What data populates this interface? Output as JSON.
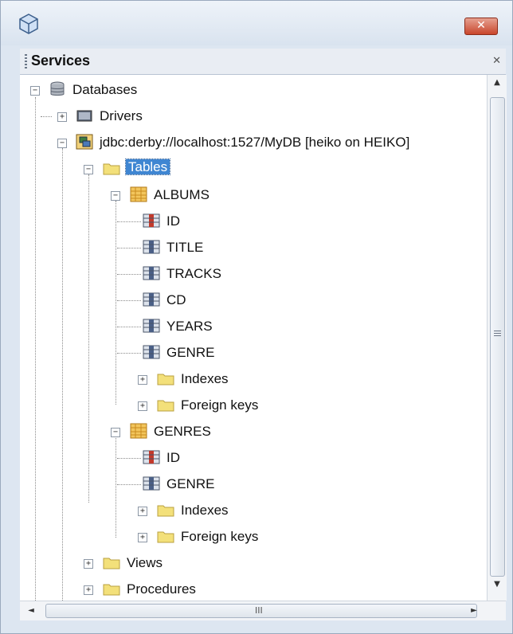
{
  "window": {
    "close_glyph": "✕"
  },
  "panel": {
    "title": "Services",
    "close_glyph": "✕"
  },
  "tree": {
    "root": "Databases",
    "drivers": "Drivers",
    "connection": "jdbc:derby://localhost:1527/MyDB [heiko on HEIKO]",
    "tables": "Tables",
    "albums": {
      "name": "ALBUMS",
      "columns": [
        "ID",
        "TITLE",
        "TRACKS",
        "CD",
        "YEARS",
        "GENRE"
      ],
      "indexes": "Indexes",
      "foreign_keys": "Foreign keys"
    },
    "genres": {
      "name": "GENRES",
      "columns": [
        "ID",
        "GENRE"
      ],
      "indexes": "Indexes",
      "foreign_keys": "Foreign keys"
    },
    "views": "Views",
    "procedures": "Procedures"
  },
  "scroll": {
    "up": "▲",
    "down": "▼",
    "left": "◄",
    "right": "►",
    "thumb_grip": "III"
  },
  "colors": {
    "selection": "#3f86d2",
    "folder": "#f3e07a",
    "close": "#c9462c"
  }
}
